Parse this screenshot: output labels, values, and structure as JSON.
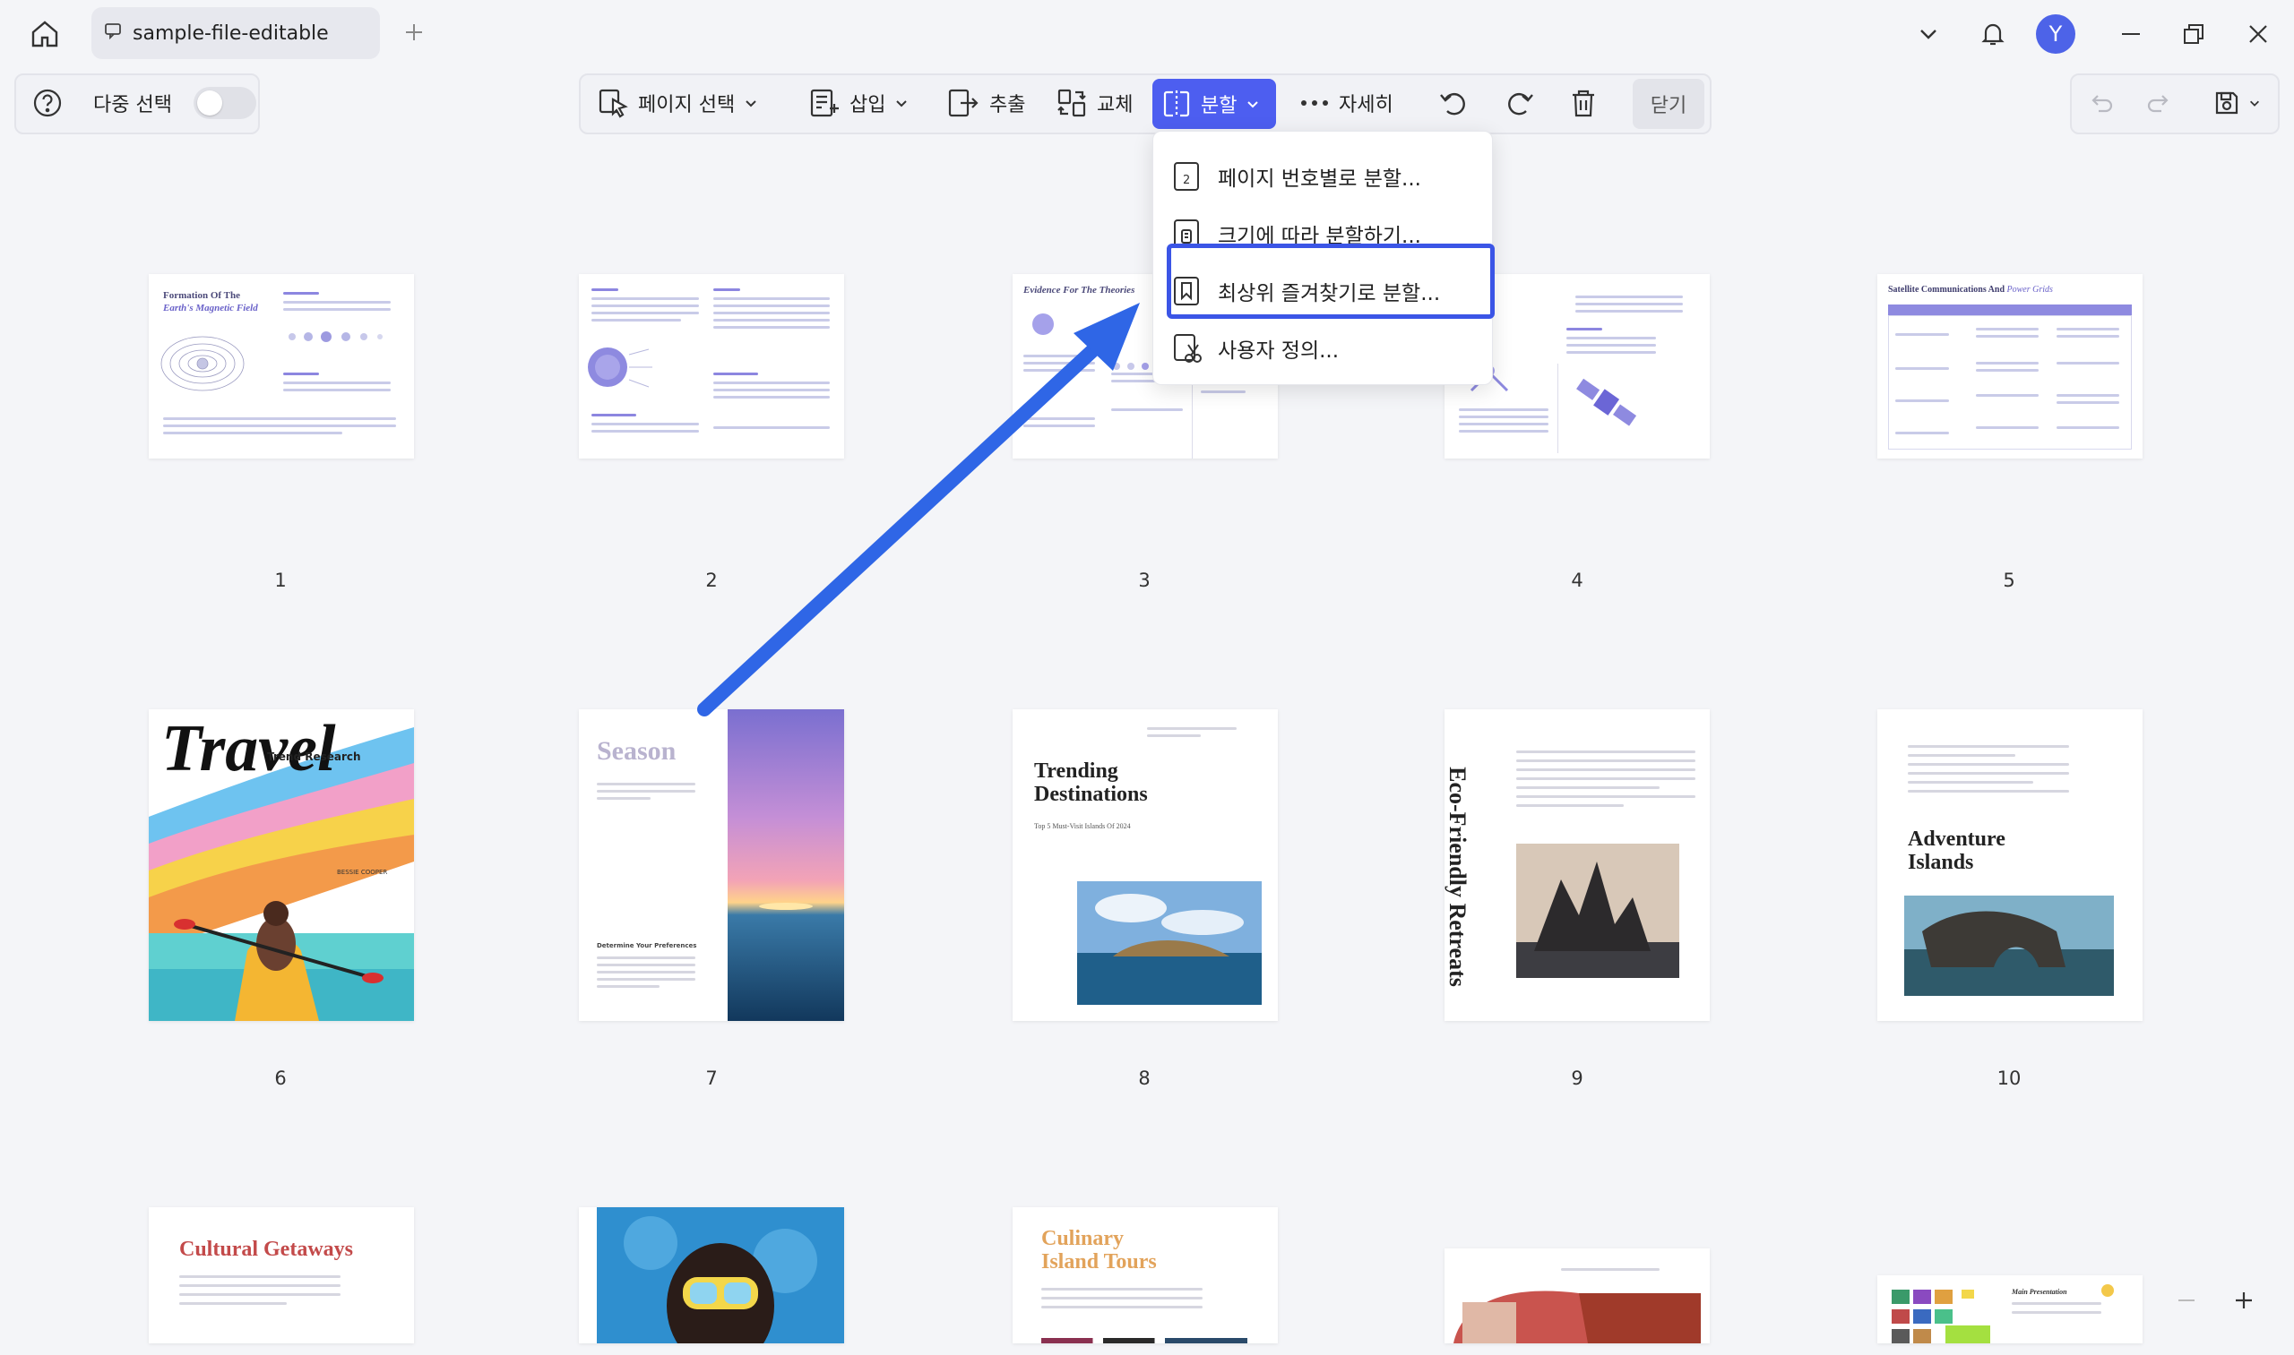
{
  "titlebar": {
    "tab_label": "sample-file-editable",
    "avatar_letter": "Y"
  },
  "toolbar": {
    "multi_select_label": "다중 선택",
    "page_select_label": "페이지 선택",
    "insert_label": "삽입",
    "extract_label": "추출",
    "replace_label": "교체",
    "split_label": "분할",
    "more_label": "자세히",
    "close_label": "닫기"
  },
  "split_menu": {
    "items": [
      {
        "label": "페이지 번호별로 분할..."
      },
      {
        "label": "크기에 따라 분할하기..."
      },
      {
        "label": "최상위 즐겨찾기로 분할..."
      },
      {
        "label": "사용자 정의..."
      }
    ]
  },
  "pages": [
    {
      "number": "1",
      "title": "Formation Of The",
      "title2": "Earth's Magnetic Field"
    },
    {
      "number": "2"
    },
    {
      "number": "3",
      "title": "Evidence For The Theories"
    },
    {
      "number": "4"
    },
    {
      "number": "5",
      "title": "Satellite Communications And",
      "title2": "Power Grids"
    },
    {
      "number": "6",
      "title": "Travel",
      "subtitle": "Trend Research",
      "author": "BESSIE COOPER"
    },
    {
      "number": "7",
      "title": "Season",
      "heading": "Determine Your Preferences"
    },
    {
      "number": "8",
      "title": "Trending",
      "title2": "Destinations",
      "subtitle": "Top 5 Must-Visit Islands Of 2024"
    },
    {
      "number": "9",
      "title": "Eco-Friendly Retreats"
    },
    {
      "number": "10",
      "title": "Adventure",
      "title2": "Islands"
    },
    {
      "number": "",
      "title": "Cultural Getaways"
    },
    {
      "number": ""
    },
    {
      "number": "",
      "title": "Culinary",
      "title2": "Island Tours"
    },
    {
      "number": ""
    },
    {
      "number": "",
      "title": "Main Presentation"
    }
  ],
  "colors": {
    "accent": "#4d5ef0",
    "highlight": "#3b55e6",
    "arrow": "#2f66e6"
  }
}
